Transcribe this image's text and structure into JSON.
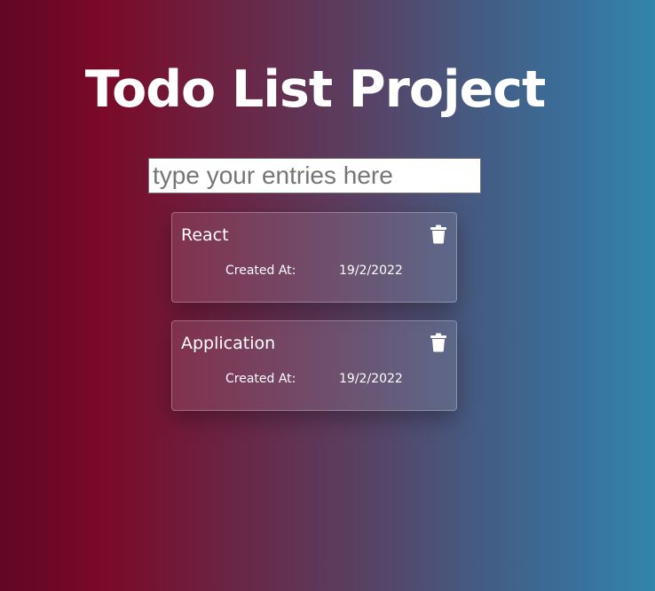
{
  "header": {
    "title": "Todo List Project"
  },
  "entry": {
    "placeholder": "type your entries here",
    "value": ""
  },
  "todos": [
    {
      "title": "React",
      "created_label": "Created At:",
      "created_date": "19/2/2022",
      "delete_icon": "trash-icon"
    },
    {
      "title": "Application",
      "created_label": "Created At:",
      "created_date": "19/2/2022",
      "delete_icon": "trash-icon"
    }
  ],
  "colors": {
    "background_left": "#620626",
    "background_mid": "#7a0a28",
    "background_right": "#3286ab",
    "text": "#ffffff"
  }
}
